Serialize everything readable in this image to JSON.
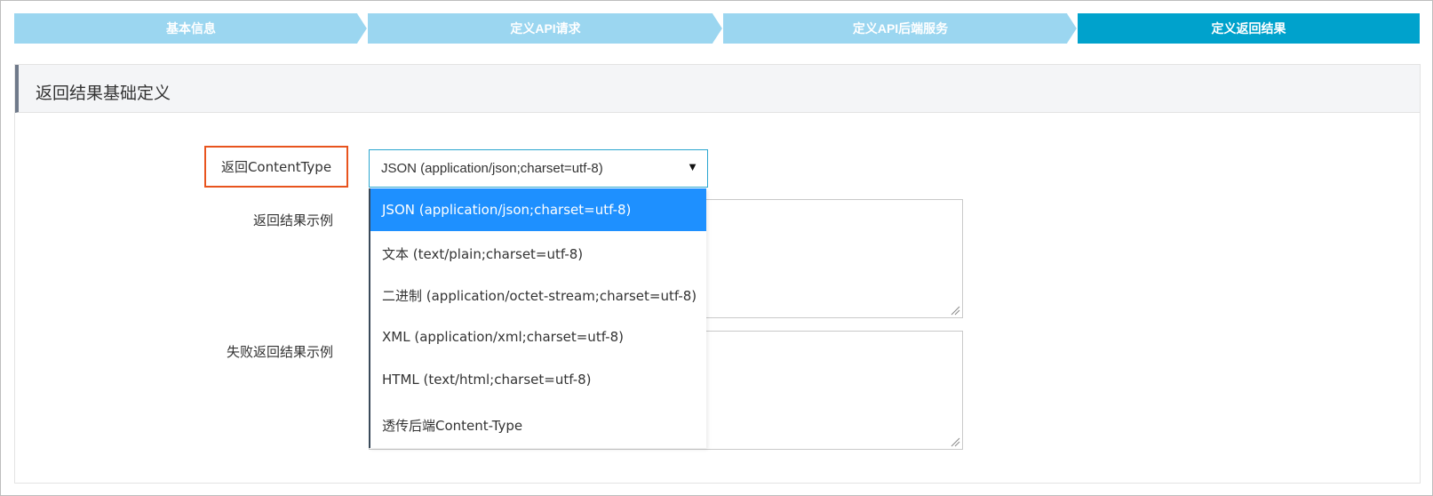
{
  "steps": [
    {
      "label": "基本信息",
      "state": "done"
    },
    {
      "label": "定义API请求",
      "state": "done"
    },
    {
      "label": "定义API后端服务",
      "state": "done"
    },
    {
      "label": "定义返回结果",
      "state": "active"
    }
  ],
  "colors": {
    "step_done": "#9bd6f0",
    "step_active": "#00a2cc",
    "highlight_border": "#e8541e",
    "option_selected": "#1e90ff"
  },
  "panel": {
    "title": "返回结果基础定义"
  },
  "form": {
    "content_type_label": "返回ContentType",
    "content_type_value": "JSON (application/json;charset=utf-8)",
    "result_example_label": "返回结果示例",
    "failure_example_label": "失败返回结果示例"
  },
  "dropdown": {
    "options": [
      {
        "label": "JSON (application/json;charset=utf-8)",
        "selected": true
      },
      {
        "label": "文本 (text/plain;charset=utf-8)",
        "selected": false
      },
      {
        "label": "二进制 (application/octet-stream;charset=utf-8)",
        "selected": false
      },
      {
        "label": "XML (application/xml;charset=utf-8)",
        "selected": false
      },
      {
        "label": "HTML (text/html;charset=utf-8)",
        "selected": false
      },
      {
        "label": "透传后端Content-Type",
        "selected": false
      }
    ]
  }
}
